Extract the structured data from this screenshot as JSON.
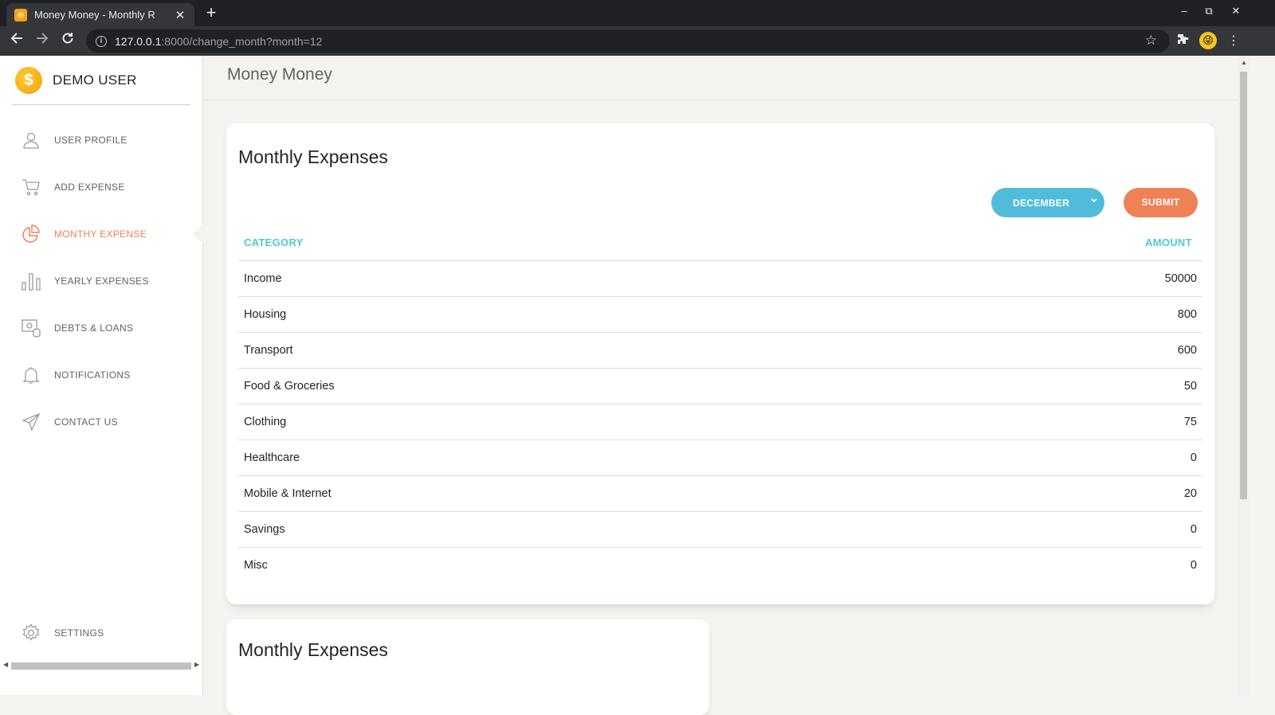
{
  "browser": {
    "tab_title": "Money Money - Monthly R",
    "tab_close": "✕",
    "new_tab": "+",
    "url_host": "127.0.0.1",
    "url_path": ":8000/change_month?month=12",
    "window_controls": [
      "–",
      "⧉",
      "✕"
    ]
  },
  "sidebar": {
    "brand": "DEMO USER",
    "items": [
      {
        "label": "USER PROFILE",
        "icon": "user-icon",
        "active": false
      },
      {
        "label": "ADD EXPENSE",
        "icon": "cart-icon",
        "active": false
      },
      {
        "label": "MONTHY EXPENSE",
        "icon": "pie-chart-icon",
        "active": true
      },
      {
        "label": "YEARLY EXPENSES",
        "icon": "bar-chart-icon",
        "active": false
      },
      {
        "label": "DEBTS & LOANS",
        "icon": "bank-icon",
        "active": false
      },
      {
        "label": "NOTIFICATIONS",
        "icon": "bell-icon",
        "active": false
      },
      {
        "label": "CONTACT US",
        "icon": "send-icon",
        "active": false
      }
    ],
    "settings_label": "SETTINGS"
  },
  "topnav": {
    "brand": "Money Money"
  },
  "main": {
    "card_title": "Monthly Expenses",
    "month_select": "DECEMBER",
    "submit_label": "SUBMIT",
    "table": {
      "headers": [
        "CATEGORY",
        "AMOUNT"
      ],
      "rows": [
        {
          "category": "Income",
          "amount": "50000"
        },
        {
          "category": "Housing",
          "amount": "800"
        },
        {
          "category": "Transport",
          "amount": "600"
        },
        {
          "category": "Food & Groceries",
          "amount": "50"
        },
        {
          "category": "Clothing",
          "amount": "75"
        },
        {
          "category": "Healthcare",
          "amount": "0"
        },
        {
          "category": "Mobile & Internet",
          "amount": "20"
        },
        {
          "category": "Savings",
          "amount": "0"
        },
        {
          "category": "Misc",
          "amount": "0"
        }
      ]
    },
    "second_card_title": "Monthly Expenses"
  },
  "colors": {
    "accent_orange": "#ef8157",
    "accent_cyan": "#51cbce",
    "select_blue": "#51bcda"
  }
}
